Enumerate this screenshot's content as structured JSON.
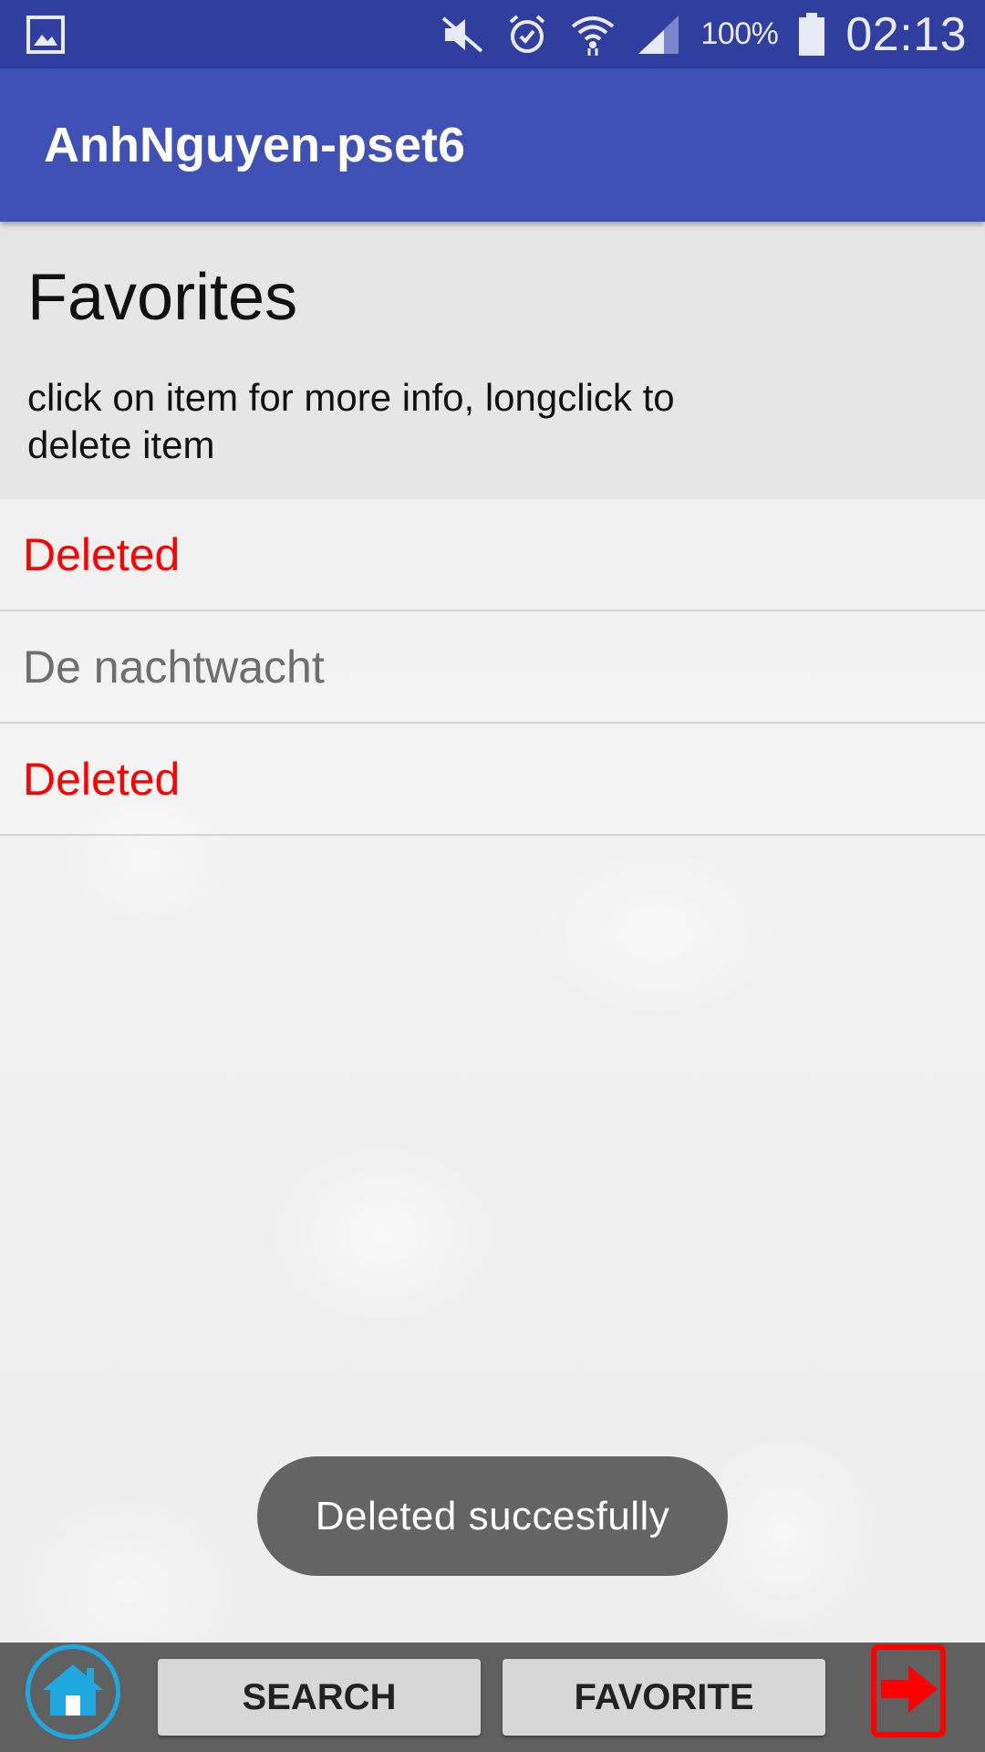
{
  "status_bar": {
    "battery": "100%",
    "time": "02:13",
    "icons": [
      "gallery-icon",
      "mute-icon",
      "alarm-icon",
      "wifi-icon",
      "signal-icon",
      "battery-icon"
    ]
  },
  "app_bar": {
    "title": "AnhNguyen-pset6"
  },
  "page": {
    "title": "Favorites",
    "subtitle": "click on item for more info, longclick to delete item"
  },
  "list": {
    "items": [
      {
        "label": "Deleted",
        "status": "deleted"
      },
      {
        "label": "De nachtwacht",
        "status": "normal"
      },
      {
        "label": "Deleted",
        "status": "deleted"
      }
    ]
  },
  "toast": {
    "message": "Deleted succesfully"
  },
  "bottom_nav": {
    "home_icon": "home-icon",
    "search_label": "SEARCH",
    "favorite_label": "FAVORITE",
    "logout_icon": "logout-icon"
  },
  "colors": {
    "status_bar": "#303f9f",
    "app_bar": "#3f51b5",
    "deleted_text": "#ff0000",
    "normal_text": "#6e6e6e",
    "home_icon": "#1fa8e0",
    "logout_icon": "#ff0000"
  }
}
